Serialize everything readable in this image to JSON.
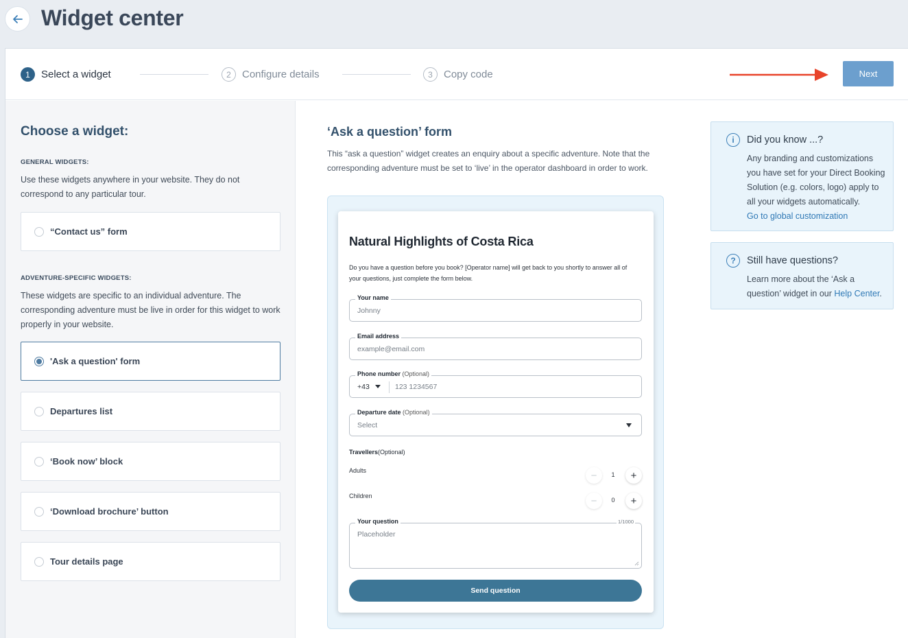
{
  "header": {
    "title": "Widget center"
  },
  "stepper": {
    "steps": [
      {
        "num": "1",
        "label": "Select a widget"
      },
      {
        "num": "2",
        "label": "Configure details"
      },
      {
        "num": "3",
        "label": "Copy code"
      }
    ],
    "next_label": "Next"
  },
  "left": {
    "title": "Choose a widget:",
    "general": {
      "title": "GENERAL WIDGETS:",
      "desc": "Use these widgets anywhere in your website. They do not correspond to any particular tour.",
      "options": [
        "“Contact us” form"
      ]
    },
    "adventure": {
      "title": "ADVENTURE-SPECIFIC WIDGETS:",
      "desc": "These widgets are specific to an individual adventure. The corresponding adventure must be live in order for this widget to work properly in your website.",
      "options": [
        "'Ask a question' form",
        "Departures list",
        "‘Book now’ block",
        "‘Download brochure’ button",
        "Tour details page"
      ]
    }
  },
  "middle": {
    "title": "‘Ask a question’ form",
    "desc": "This “ask a question” widget creates an enquiry about a specific adventure. Note that the corresponding adventure must be set to ‘live’ in the operator dashboard in order to work.",
    "preview": {
      "title": "Natural Highlights of Costa Rica",
      "desc": "Do you have a question before you book? [Operator name] will get back to you shortly to answer all of your questions, just complete the form below.",
      "name_label": "Your name",
      "name_placeholder": "Johnny",
      "email_label": "Email address",
      "email_placeholder": "example@email.com",
      "phone_label": "Phone number",
      "optional": "(Optional)",
      "phone_code": "+43",
      "phone_placeholder": "123 1234567",
      "departure_label": "Departure date",
      "departure_value": "Select",
      "travellers_label": "Travellers",
      "adults_label": "Adults",
      "adults_value": "1",
      "children_label": "Children",
      "children_value": "0",
      "question_label": "Your question",
      "question_count": "1/1000",
      "question_placeholder": "Placeholder",
      "send_label": "Send question"
    }
  },
  "right": {
    "did_you_know": {
      "title": "Did you know ...?",
      "body": "Any branding and customizations you have set for your Direct Booking Solution (e.g. colors, logo) apply to all your widgets automatically.",
      "link": "Go to global customization"
    },
    "questions": {
      "title": "Still have questions?",
      "body_prefix": "Learn more about the ‘Ask a question’ widget in our ",
      "link": "Help Center",
      "body_suffix": "."
    }
  },
  "colors": {
    "accent": "#2e6289",
    "next_button": "#6c9fce",
    "annotation_arrow": "#e8432a"
  }
}
